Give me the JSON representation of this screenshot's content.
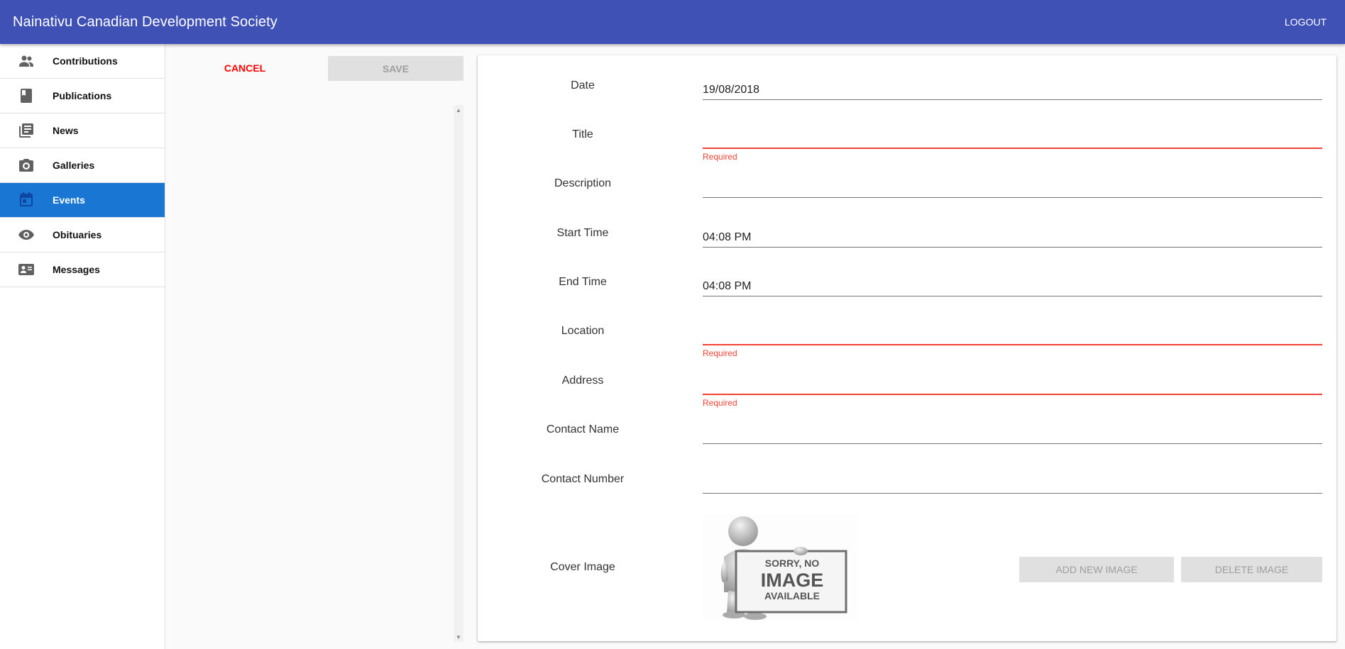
{
  "app": {
    "title": "Nainativu Canadian Development Society",
    "logout_label": "LOGOUT"
  },
  "sidebar": {
    "items": [
      {
        "label": "Contributions",
        "icon": "people-icon"
      },
      {
        "label": "Publications",
        "icon": "book-icon"
      },
      {
        "label": "News",
        "icon": "news-icon"
      },
      {
        "label": "Galleries",
        "icon": "camera-icon"
      },
      {
        "label": "Events",
        "icon": "calendar-icon",
        "active": true
      },
      {
        "label": "Obituaries",
        "icon": "eye-icon"
      },
      {
        "label": "Messages",
        "icon": "contact-card-icon"
      }
    ]
  },
  "actions": {
    "cancel_label": "CANCEL",
    "save_label": "SAVE"
  },
  "form": {
    "fields": [
      {
        "label": "Date",
        "value": "19/08/2018",
        "error": ""
      },
      {
        "label": "Title",
        "value": "",
        "error": "Required"
      },
      {
        "label": "Description",
        "value": "",
        "error": ""
      },
      {
        "label": "Start Time",
        "value": "04:08 PM",
        "error": ""
      },
      {
        "label": "End Time",
        "value": "04:08 PM",
        "error": ""
      },
      {
        "label": "Location",
        "value": "",
        "error": "Required"
      },
      {
        "label": "Address",
        "value": "",
        "error": "Required"
      },
      {
        "label": "Contact Name",
        "value": "",
        "error": ""
      },
      {
        "label": "Contact Number",
        "value": "",
        "error": ""
      }
    ],
    "cover_image": {
      "label": "Cover Image",
      "placeholder_text": [
        "SORRY, NO",
        "IMAGE",
        "AVAILABLE"
      ],
      "add_label": "ADD NEW IMAGE",
      "delete_label": "DELETE IMAGE"
    }
  },
  "colors": {
    "appbar": "#3f51b5",
    "active_nav": "#1976d2",
    "error": "#f44336",
    "cancel": "#ff0000"
  }
}
